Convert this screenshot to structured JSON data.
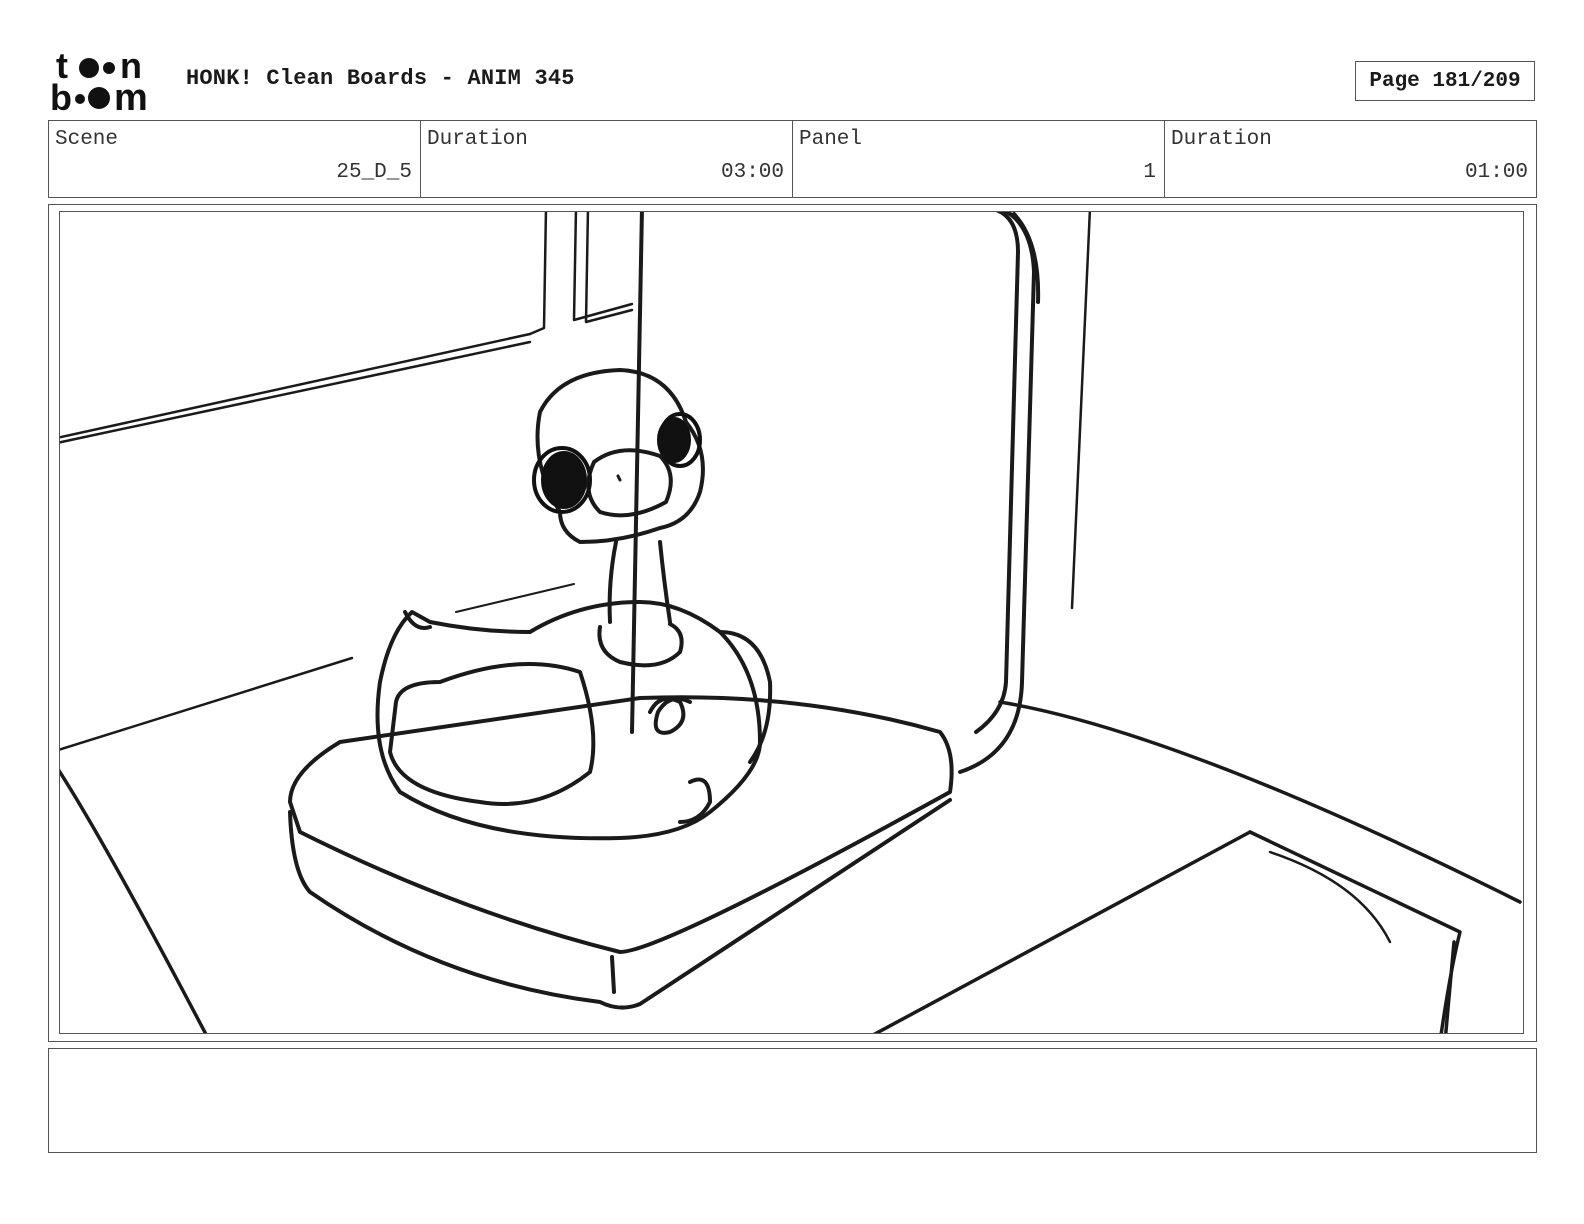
{
  "logo": {
    "line1": "to•n",
    "line2": "b••m",
    "brand": "toon boom"
  },
  "header": {
    "title": "HONK! Clean Boards - ANIM 345",
    "page": "Page 181/209"
  },
  "info": [
    {
      "label": "Scene",
      "value": "25_D_5"
    },
    {
      "label": "Duration",
      "value": "03:00"
    },
    {
      "label": "Panel",
      "value": "1"
    },
    {
      "label": "Duration",
      "value": "01:00"
    }
  ],
  "notes": {
    "text": ""
  }
}
